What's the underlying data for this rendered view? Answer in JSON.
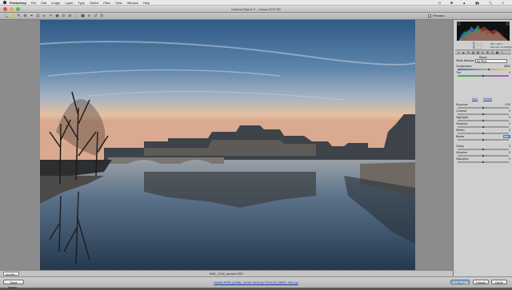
{
  "menubar": {
    "app": "Photoshop",
    "items": [
      "File",
      "Edit",
      "Image",
      "Layer",
      "Type",
      "Select",
      "Filter",
      "View",
      "Window",
      "Help"
    ],
    "right": [
      "◷",
      "✱",
      "▲",
      "▮▮",
      "🔍",
      "≡"
    ]
  },
  "window": {
    "title": "Camera Raw 8.3  –  Canon EOS 5D"
  },
  "toolbar": {
    "tools": [
      "🔍",
      "✋",
      "✎",
      "⊕",
      "⌖",
      "⊡",
      "⦡",
      "✂",
      "◉",
      "⊙",
      "⊘",
      "⬚",
      "▣",
      "≡",
      "↺",
      "↻"
    ],
    "preview_label": "Preview",
    "preview_checked": "✓"
  },
  "canvas": {
    "zoom": "15.3%",
    "filename": "IMG_1234_sunset.CR2"
  },
  "bottombar": {
    "save_label": "Save Image...",
    "workflow_text": "Adobe RGB (1998); 16 bit; 5616 by 3744 (21.0MP); 300 ppi",
    "open_label": "Open Image",
    "cancel_label": "Cancel",
    "done_label": "Done"
  },
  "panel": {
    "readout": {
      "r": "R:  ---   ---",
      "g": "G:  ---   ---",
      "b": "B:  ---   ---",
      "meta": "f/8.0  1/60 s\nISO 100  24-105@24 mm"
    },
    "tabs": [
      "◐",
      "▲",
      "≋",
      "▤",
      "▥",
      "fx",
      "⊞",
      "◫",
      "▣",
      "≡"
    ],
    "section": "Basic",
    "wb": {
      "label": "White Balance:",
      "value": "As Shot"
    },
    "auto": "Auto",
    "default": "Default",
    "sliders": [
      {
        "label": "Temperature",
        "value": "5850",
        "pos": 0.62
      },
      {
        "label": "Tint",
        "value": "0",
        "pos": 0.5
      },
      {
        "label": "Exposure",
        "value": "0.00",
        "pos": 0.5
      },
      {
        "label": "Contrast",
        "value": "0",
        "pos": 0.5
      },
      {
        "label": "Highlights",
        "value": "0",
        "pos": 0.5
      },
      {
        "label": "Shadows",
        "value": "0",
        "pos": 0.5
      },
      {
        "label": "Whites",
        "value": "0",
        "pos": 0.5
      },
      {
        "label": "Blacks",
        "value": "0",
        "pos": 0.5
      },
      {
        "label": "Clarity",
        "value": "0",
        "pos": 0.5
      },
      {
        "label": "Vibrance",
        "value": "0",
        "pos": 0.5
      },
      {
        "label": "Saturation",
        "value": "0",
        "pos": 0.5
      }
    ]
  },
  "colors": {
    "accent": "#4b8fd7",
    "link": "#1a3fb0"
  }
}
